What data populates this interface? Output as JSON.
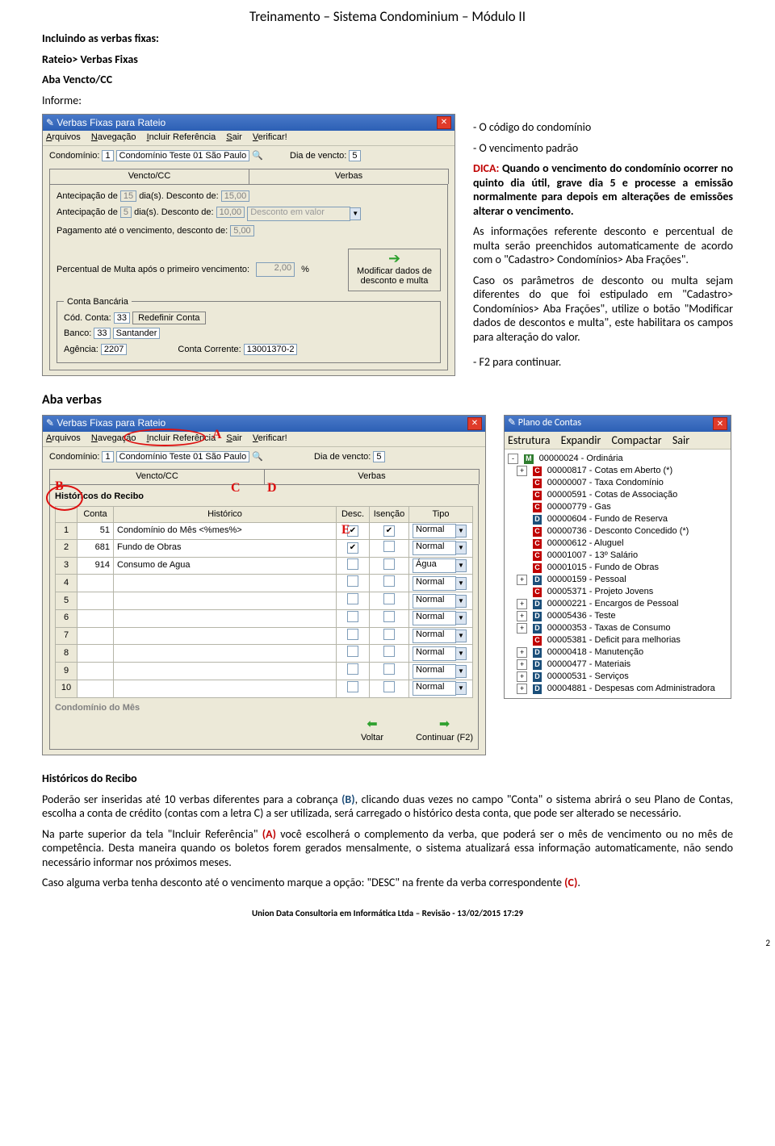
{
  "header": "Treinamento – Sistema Condominium – Módulo II",
  "sec_incluindo": "Incluindo as verbas fixas:",
  "sec_rateio": "Rateio> Verbas Fixas",
  "sec_aba": "Aba Vencto/CC",
  "sec_informe": "Informe:",
  "win1": {
    "title": "Verbas Fixas para Rateio",
    "menu": {
      "arquivos": "Arquivos",
      "navegacao": "Navegação",
      "incluir": "Incluir Referência",
      "sair": "Sair",
      "verificar": "Verificar!"
    },
    "condominio_lbl": "Condomínio:",
    "condominio_code": "1",
    "condominio_nome": "Condomínio Teste 01 São Paulo",
    "dia_vencto_lbl": "Dia de vencto:",
    "dia_vencto": "5",
    "tab_vencto": "Vencto/CC",
    "tab_verbas": "Verbas",
    "antecip_lbl": "Antecipação de",
    "dias_desc": "dia(s). Desconto de:",
    "a1": "15",
    "a1v": "15,00",
    "a2": "5",
    "a2v": "10,00",
    "desc_em_valor": "Desconto em valor",
    "pag_ate_lbl": "Pagamento até o vencimento, desconto de:",
    "pag_ate_v": "5,00",
    "multa_lbl": "Percentual de Multa após o primeiro vencimento:",
    "multa_v": "2,00",
    "multa_pct": "%",
    "btn_mod1": "Modificar dados de",
    "btn_mod2": "desconto e multa",
    "conta_titulo": "Conta Bancária",
    "cod_conta_lbl": "Cód. Conta:",
    "cod_conta": "33",
    "redef": "Redefinir Conta",
    "banco_lbl": "Banco:",
    "banco_cod": "33",
    "banco_nome": "Santander",
    "agencia_lbl": "Agência:",
    "agencia": "2207",
    "cc_lbl": "Conta Corrente:",
    "cc": "13001370-2"
  },
  "side": {
    "codigo": "- O código do condomínio",
    "venc": "- O vencimento padrão",
    "dica_lbl": "DICA:",
    "dica": "Quando o vencimento do condomínio ocorrer no quinto dia útil, grave dia 5 e processe a emissão normalmente para depois em alterações de emissões alterar o vencimento.",
    "p2": "As informações referente desconto e percentual de multa serão preenchidos automaticamente de acordo com o \"Cadastro> Condomínios> Aba Frações\".",
    "p3": "Caso os parâmetros de desconto ou multa sejam diferentes do que foi estipulado em \"Cadastro> Condomínios> Aba Frações\", utilize o botão \"Modificar dados de descontos e multa\", este habilitara os campos para alteração do valor.",
    "f2": "- F2 para continuar."
  },
  "aba_verbas": "Aba verbas",
  "win2": {
    "title": "Verbas Fixas para Rateio",
    "hist_title": "Históricos do Recibo",
    "cols": {
      "conta": "Conta",
      "hist": "Histórico",
      "desc": "Desc.",
      "isen": "Isenção",
      "tipo": "Tipo"
    },
    "rows": [
      {
        "n": "1",
        "conta": "51",
        "hist": "Condomínio do Mês <%mes%>",
        "d": true,
        "i": true,
        "tipo": "Normal"
      },
      {
        "n": "2",
        "conta": "681",
        "hist": "Fundo de Obras",
        "d": true,
        "i": false,
        "tipo": "Normal"
      },
      {
        "n": "3",
        "conta": "914",
        "hist": "Consumo de Agua",
        "d": false,
        "i": false,
        "tipo": "Água"
      },
      {
        "n": "4",
        "conta": "",
        "hist": "",
        "d": false,
        "i": false,
        "tipo": "Normal"
      },
      {
        "n": "5",
        "conta": "",
        "hist": "",
        "d": false,
        "i": false,
        "tipo": "Normal"
      },
      {
        "n": "6",
        "conta": "",
        "hist": "",
        "d": false,
        "i": false,
        "tipo": "Normal"
      },
      {
        "n": "7",
        "conta": "",
        "hist": "",
        "d": false,
        "i": false,
        "tipo": "Normal"
      },
      {
        "n": "8",
        "conta": "",
        "hist": "",
        "d": false,
        "i": false,
        "tipo": "Normal"
      },
      {
        "n": "9",
        "conta": "",
        "hist": "",
        "d": false,
        "i": false,
        "tipo": "Normal"
      },
      {
        "n": "10",
        "conta": "",
        "hist": "",
        "d": false,
        "i": false,
        "tipo": "Normal"
      }
    ],
    "sel_text": "Condomínio do Mês",
    "voltar": "Voltar",
    "continuar": "Continuar (F2)"
  },
  "plano": {
    "title": "Plano de Contas",
    "menu": {
      "estrutura": "Estrutura",
      "exp": "Expandir",
      "comp": "Compactar",
      "sair": "Sair"
    },
    "items": [
      {
        "e": "-",
        "t": "M",
        "txt": "00000024 - Ordinária"
      },
      {
        "e": "+",
        "t": "C",
        "txt": "00000817 - Cotas em Aberto (*)"
      },
      {
        "e": "",
        "t": "C",
        "txt": "00000007 - Taxa Condomínio"
      },
      {
        "e": "",
        "t": "C",
        "txt": "00000591 - Cotas de Associação"
      },
      {
        "e": "",
        "t": "C",
        "txt": "00000779 - Gas"
      },
      {
        "e": "",
        "t": "D",
        "txt": "00000604 - Fundo de Reserva"
      },
      {
        "e": "",
        "t": "C",
        "txt": "00000736 - Desconto Concedido (*)"
      },
      {
        "e": "",
        "t": "C",
        "txt": "00000612 - Aluguel"
      },
      {
        "e": "",
        "t": "C",
        "txt": "00001007 - 13º Salário"
      },
      {
        "e": "",
        "t": "C",
        "txt": "00001015 - Fundo de Obras"
      },
      {
        "e": "+",
        "t": "D",
        "txt": "00000159 - Pessoal"
      },
      {
        "e": "",
        "t": "C",
        "txt": "00005371 - Projeto Jovens"
      },
      {
        "e": "+",
        "t": "D",
        "txt": "00000221 - Encargos de Pessoal"
      },
      {
        "e": "+",
        "t": "D",
        "txt": "00005436 - Teste"
      },
      {
        "e": "+",
        "t": "D",
        "txt": "00000353 - Taxas de Consumo"
      },
      {
        "e": "",
        "t": "C",
        "txt": "00005381 - Deficit para melhorias"
      },
      {
        "e": "+",
        "t": "D",
        "txt": "00000418 - Manutenção"
      },
      {
        "e": "+",
        "t": "D",
        "txt": "00000477 - Materiais"
      },
      {
        "e": "+",
        "t": "D",
        "txt": "00000531 - Serviços"
      },
      {
        "e": "+",
        "t": "D",
        "txt": "00004881 - Despesas com Administradora"
      }
    ]
  },
  "body2": {
    "h": "Históricos do Recibo",
    "p1a": "Poderão ser inseridas até 10 verbas diferentes para a cobrança ",
    "p1b": "(B)",
    "p1c": ", clicando duas vezes no campo \"Conta\" o sistema abrirá o seu Plano de Contas, escolha a conta de crédito (contas com a letra C) a ser utilizada, será carregado o histórico desta conta, que pode ser alterado se necessário.",
    "p2a": "Na parte superior da tela \"Incluir Referência\" ",
    "p2b": "(A)",
    "p2c": " você escolherá o complemento da verba, que poderá ser o mês de vencimento ou no mês de competência. Desta maneira quando os boletos forem gerados mensalmente, o sistema atualizará essa informação automaticamente, não sendo necessário informar nos próximos meses.",
    "p3a": "Caso alguma verba tenha desconto até o vencimento marque a opção: \"DESC\" na frente da verba correspondente ",
    "p3b": "(C)",
    "p3c": "."
  },
  "footer": "Union Data Consultoria em Informática Ltda – Revisão - 13/02/2015 17:29",
  "pg": "2"
}
